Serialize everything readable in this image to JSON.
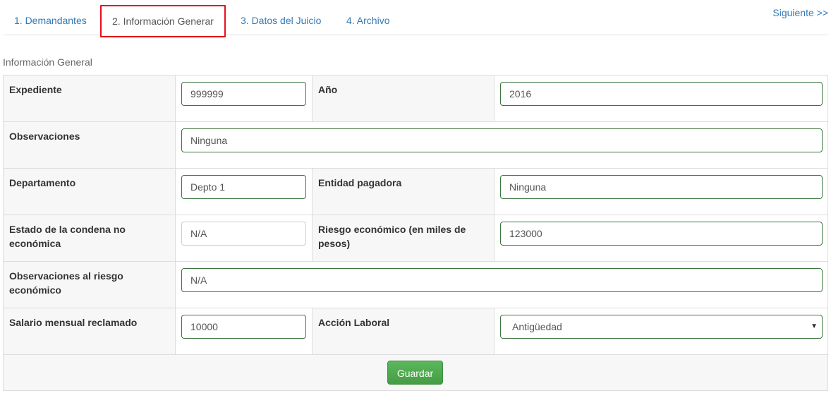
{
  "tabs": [
    {
      "label": "1. Demandantes"
    },
    {
      "label": "2. Información Generar"
    },
    {
      "label": "3. Datos del Juicio"
    },
    {
      "label": "4. Archivo"
    }
  ],
  "next_link": "Siguiente >>",
  "section_title": "Información General",
  "form": {
    "expediente": {
      "label": "Expediente",
      "value": "999999"
    },
    "anio": {
      "label": "Año",
      "value": "2016"
    },
    "observaciones": {
      "label": "Observaciones",
      "value": "Ninguna"
    },
    "departamento": {
      "label": "Departamento",
      "value": "Depto 1"
    },
    "entidad_pagadora": {
      "label": "Entidad pagadora",
      "value": "Ninguna"
    },
    "estado_condena": {
      "label": "Estado de la condena no económica",
      "value": "N/A"
    },
    "riesgo_economico": {
      "label": "Riesgo económico (en miles de pesos)",
      "value": "123000"
    },
    "obs_riesgo": {
      "label": "Observaciones al riesgo económico",
      "value": "N/A"
    },
    "salario": {
      "label": "Salario mensual reclamado",
      "value": "10000"
    },
    "accion_laboral": {
      "label": "Acción Laboral",
      "value": "Antigüedad"
    }
  },
  "save_label": "Guardar",
  "colors": {
    "link": "#337ab7",
    "active_tab_border": "#e3101a",
    "field_border_valid": "#3c763d",
    "save_button": "#5cb85c"
  }
}
